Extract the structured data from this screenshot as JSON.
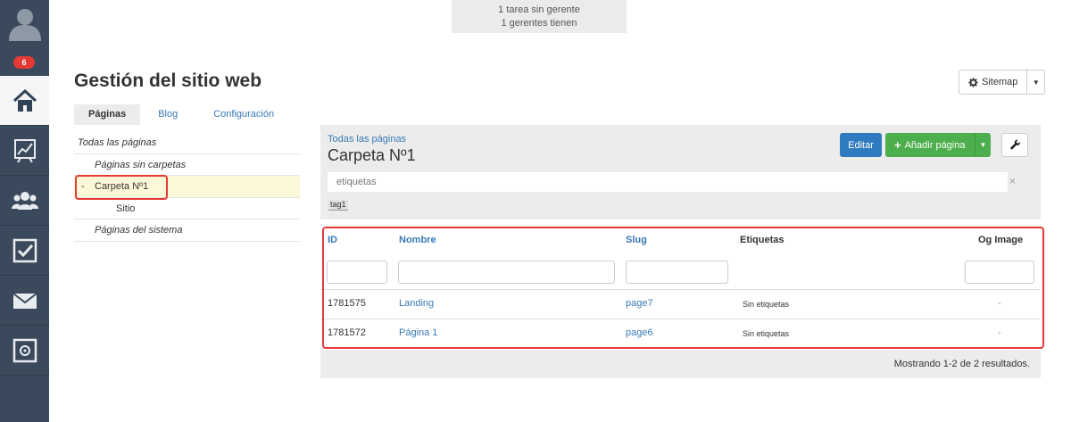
{
  "sidebar": {
    "badge_count": "6",
    "items": [
      {
        "icon": "home-icon",
        "active": true
      },
      {
        "icon": "chart-icon"
      },
      {
        "icon": "users-icon"
      },
      {
        "icon": "checkbox-icon"
      },
      {
        "icon": "mail-icon"
      },
      {
        "icon": "safe-icon"
      }
    ]
  },
  "notice": {
    "line1": "1 tarea sin gerente",
    "line2": "1 gerentes tienen"
  },
  "header": {
    "title": "Gestión del sitio web",
    "sitemap_label": "Sitemap"
  },
  "tabs": [
    {
      "label": "Páginas",
      "active": true
    },
    {
      "label": "Blog"
    },
    {
      "label": "Configuración"
    }
  ],
  "tree": {
    "items": [
      {
        "label": "Todas las páginas"
      },
      {
        "label": "Páginas sin carpetas"
      },
      {
        "label": "Carpeta Nº1",
        "prefix": "-"
      },
      {
        "label": "Sitio"
      },
      {
        "label": "Páginas del sistema"
      }
    ]
  },
  "panel": {
    "breadcrumb": "Todas las páginas",
    "folder_title": "Carpeta Nº1",
    "edit_label": "Editar",
    "add_label": "Añadir página",
    "tags_placeholder": "etiquetas",
    "tags_clear": "×",
    "tag": "tag1"
  },
  "table": {
    "headers": {
      "id": "ID",
      "name": "Nombre",
      "slug": "Slug",
      "tags": "Etiquetas",
      "og": "Og Image"
    },
    "rows": [
      {
        "id": "1781575",
        "name": "Landing",
        "slug": "page7",
        "tags": "Sin etiquetas",
        "og": "-"
      },
      {
        "id": "1781572",
        "name": "Página 1",
        "slug": "page6",
        "tags": "Sin etiquetas",
        "og": "-"
      }
    ],
    "summary": "Mostrando 1-2 de 2 resultados."
  },
  "colors": {
    "sidebar_bg": "#3a4a5c",
    "link": "#3a79b5",
    "primary": "#2f7bbf",
    "success": "#4cae4c",
    "highlight": "#e53935"
  }
}
